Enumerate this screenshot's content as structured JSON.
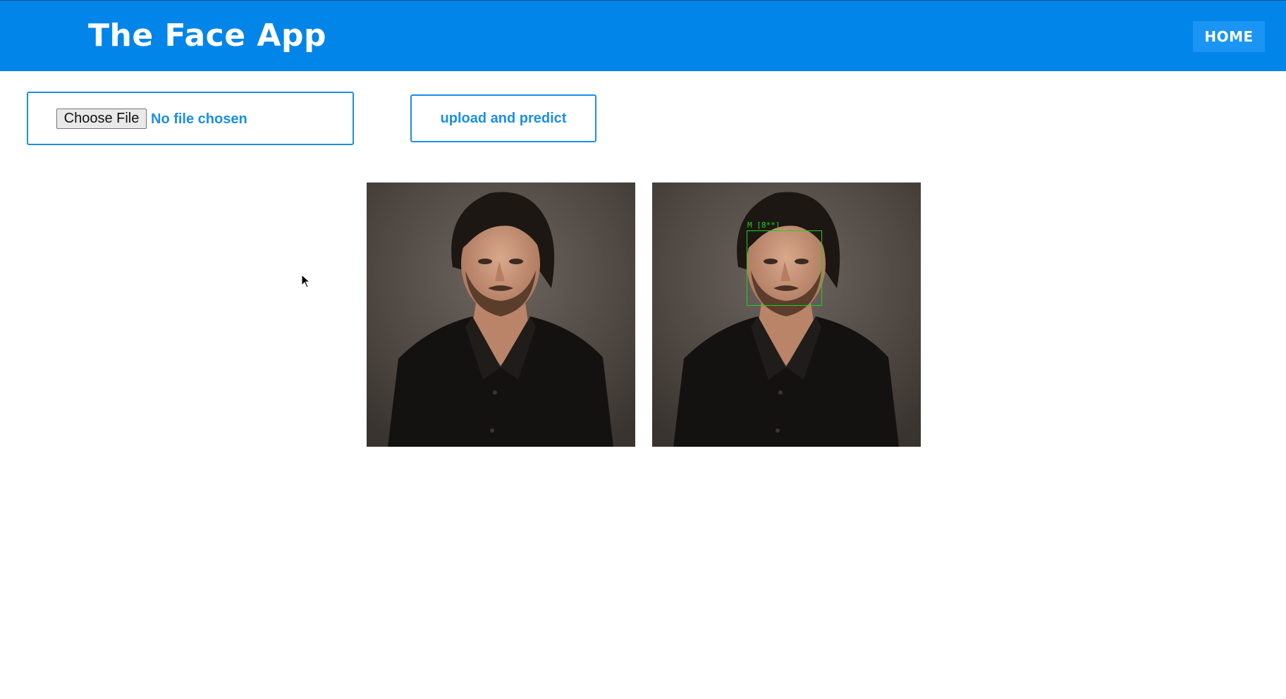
{
  "header": {
    "brand": "The Face App",
    "home_label": "HOME"
  },
  "form": {
    "choose_file_label": "Choose File",
    "file_status": "No file chosen",
    "upload_label": "upload and predict"
  },
  "results": {
    "prediction_label": "M [8**]"
  },
  "colors": {
    "navbar": "#0285e8",
    "accent": "#1a8fe8",
    "detection_box": "#1bd21b"
  },
  "icons": {
    "cursor": "mouse-pointer-icon"
  }
}
